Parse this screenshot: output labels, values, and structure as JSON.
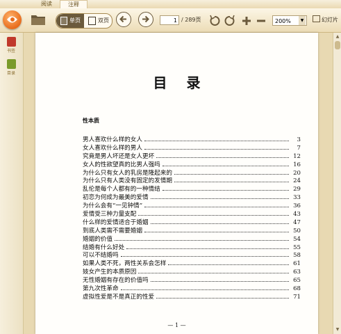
{
  "tabs": [
    {
      "label": "阅读",
      "active": false
    },
    {
      "label": "注释",
      "active": true
    }
  ],
  "toolbar": {
    "view_modes": [
      {
        "label": "单页",
        "active": true
      },
      {
        "label": "双页",
        "active": false
      }
    ],
    "current_page": "1",
    "total_pages": "/ 289页",
    "zoom": "200%",
    "slideshow_label": "幻灯片"
  },
  "sidebar": {
    "items": [
      {
        "label": "书签",
        "icon": "bookmark-icon"
      },
      {
        "label": "目录",
        "icon": "contents-icon"
      }
    ]
  },
  "document": {
    "title": "目录",
    "section": "性本质",
    "toc": [
      {
        "title": "男人喜欢什么样的女人",
        "page": "3"
      },
      {
        "title": "女人喜欢什么样的男人",
        "page": "7"
      },
      {
        "title": "究竟是男人坏还是女人更坏",
        "page": "12"
      },
      {
        "title": "女人的性欲望真的比男人强吗",
        "page": "16"
      },
      {
        "title": "为什么只有女人的乳房是隆起来的",
        "page": "20"
      },
      {
        "title": "为什么只有人类没有固定的发情期",
        "page": "24"
      },
      {
        "title": "乱伦是每个人都有的一种情结",
        "page": "29"
      },
      {
        "title": "初恋为何成为最美的爱情",
        "page": "33"
      },
      {
        "title": "为什么会有“一见钟情”",
        "page": "36"
      },
      {
        "title": "爱情受三种力量支配",
        "page": "43"
      },
      {
        "title": "什么样的爱情适合于婚姻",
        "page": "47"
      },
      {
        "title": "到底人类需不需要婚姻",
        "page": "50"
      },
      {
        "title": "婚姻的价值",
        "page": "54"
      },
      {
        "title": "结婚有什么好处",
        "page": "55"
      },
      {
        "title": "可以不结婚吗",
        "page": "58"
      },
      {
        "title": "如果人类不死，两性关系会怎样",
        "page": "61"
      },
      {
        "title": "妓女产生的本质原因",
        "page": "63"
      },
      {
        "title": "无性婚姻有存在的价值吗",
        "page": "65"
      },
      {
        "title": "第九次性革命",
        "page": "68"
      },
      {
        "title": "虚拟性爱是不是真正的性爱",
        "page": "71"
      }
    ],
    "page_footer": "— 1 —"
  },
  "colors": {
    "chrome": "#efe6cc",
    "accent": "#e86c1c",
    "button_dark": "#6b5a3c"
  }
}
